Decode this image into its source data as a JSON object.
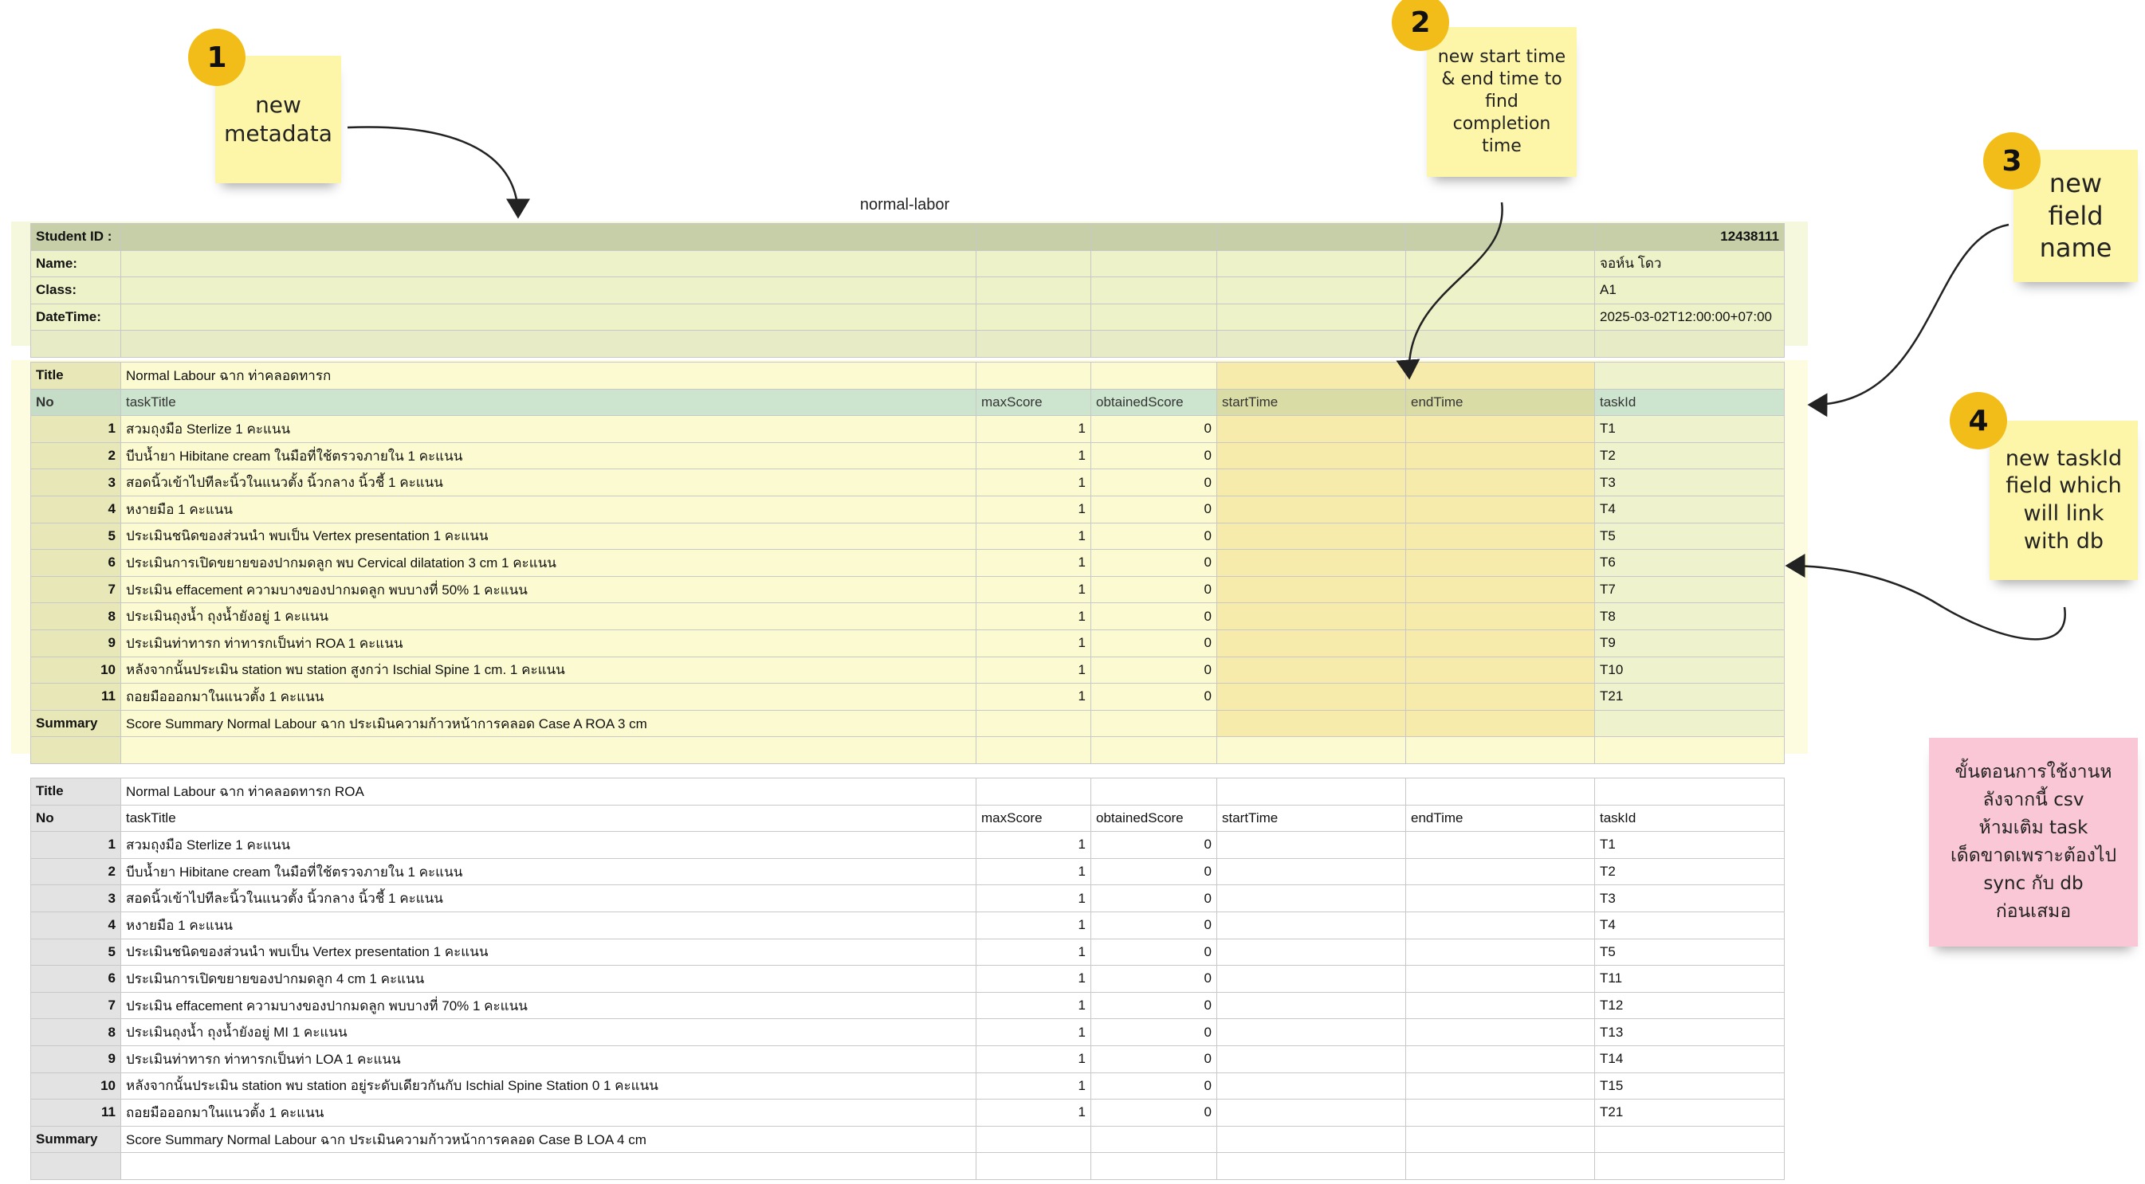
{
  "sheet_title": "normal-labor",
  "meta": {
    "rows": [
      {
        "label": "Student ID :",
        "value": "12438111"
      },
      {
        "label": "Name:",
        "value": "จอห์น โดว"
      },
      {
        "label": "Class:",
        "value": "A1"
      },
      {
        "label": "DateTime:",
        "value": "2025-03-02T12:00:00+07:00"
      }
    ]
  },
  "columns": [
    "No",
    "taskTitle",
    "maxScore",
    "obtainedScore",
    "startTime",
    "endTime",
    "taskId"
  ],
  "block1": {
    "title_label": "Title",
    "title": "Normal Labour ฉาก  ท่าคลอดทารก",
    "rows": [
      {
        "no": "1",
        "title": "สวมถุงมือ Sterlize 1 คะแนน",
        "max": "1",
        "obtained": "0",
        "taskId": "T1"
      },
      {
        "no": "2",
        "title": "บีบน้ำยา Hibitane cream ในมือที่ใช้ตรวจภายใน 1 คะแนน",
        "max": "1",
        "obtained": "0",
        "taskId": "T2"
      },
      {
        "no": "3",
        "title": "สอดนิ้วเข้าไปทีละนิ้วในแนวตั้ง นิ้วกลาง นิ้วชี้ 1 คะแนน",
        "max": "1",
        "obtained": "0",
        "taskId": "T3"
      },
      {
        "no": "4",
        "title": "หงายมือ 1 คะแนน",
        "max": "1",
        "obtained": "0",
        "taskId": "T4"
      },
      {
        "no": "5",
        "title": "ประเมินชนิดของส่วนนำ พบเป็น Vertex presentation 1 คะแนน",
        "max": "1",
        "obtained": "0",
        "taskId": "T5"
      },
      {
        "no": "6",
        "title": "ประเมินการเปิดขยายของปากมดลูก พบ Cervical dilatation 3 cm 1 คะแนน",
        "max": "1",
        "obtained": "0",
        "taskId": "T6"
      },
      {
        "no": "7",
        "title": "ประเมิน effacement ความบางของปากมดลูก พบบางที่ 50% 1 คะแนน",
        "max": "1",
        "obtained": "0",
        "taskId": "T7"
      },
      {
        "no": "8",
        "title": "ประเมินถุงน้ำ ถุงน้ำยังอยู่ 1 คะแนน",
        "max": "1",
        "obtained": "0",
        "taskId": "T8"
      },
      {
        "no": "9",
        "title": "ประเมินท่าทารก ท่าทารกเป็นท่า ROA 1 คะแนน",
        "max": "1",
        "obtained": "0",
        "taskId": "T9"
      },
      {
        "no": "10",
        "title": "หลังจากนั้นประเมิน station พบ station สูงกว่า Ischial Spine 1 cm. 1 คะแนน",
        "max": "1",
        "obtained": "0",
        "taskId": "T10"
      },
      {
        "no": "11",
        "title": "ถอยมือออกมาในแนวตั้ง 1 คะแนน",
        "max": "1",
        "obtained": "0",
        "taskId": "T21"
      }
    ],
    "summary_label": "Summary",
    "summary": "Score Summary Normal Labour ฉาก  ประเมินความก้าวหน้าการคลอด Case A ROA 3 cm"
  },
  "block2": {
    "title_label": "Title",
    "title": "Normal Labour ฉาก  ท่าคลอดทารก ROA",
    "rows": [
      {
        "no": "1",
        "title": "สวมถุงมือ Sterlize 1 คะแนน",
        "max": "1",
        "obtained": "0",
        "taskId": "T1"
      },
      {
        "no": "2",
        "title": "บีบน้ำยา Hibitane cream ในมือที่ใช้ตรวจภายใน 1 คะแนน",
        "max": "1",
        "obtained": "0",
        "taskId": "T2"
      },
      {
        "no": "3",
        "title": "สอดนิ้วเข้าไปทีละนิ้วในแนวตั้ง นิ้วกลาง นิ้วชี้ 1 คะแนน",
        "max": "1",
        "obtained": "0",
        "taskId": "T3"
      },
      {
        "no": "4",
        "title": "หงายมือ 1 คะแนน",
        "max": "1",
        "obtained": "0",
        "taskId": "T4"
      },
      {
        "no": "5",
        "title": "ประเมินชนิดของส่วนนำ พบเป็น Vertex presentation 1 คะแนน",
        "max": "1",
        "obtained": "0",
        "taskId": "T5"
      },
      {
        "no": "6",
        "title": "ประเมินการเปิดขยายของปากมดลูก 4 cm 1 คะแนน",
        "max": "1",
        "obtained": "0",
        "taskId": "T11"
      },
      {
        "no": "7",
        "title": "ประเมิน effacement ความบางของปากมดลูก พบบางที่ 70% 1 คะแนน",
        "max": "1",
        "obtained": "0",
        "taskId": "T12"
      },
      {
        "no": "8",
        "title": "ประเมินถุงน้ำ ถุงน้ำยังอยู่ MI 1 คะแนน",
        "max": "1",
        "obtained": "0",
        "taskId": "T13"
      },
      {
        "no": "9",
        "title": "ประเมินท่าทารก ท่าทารกเป็นท่า LOA 1 คะแนน",
        "max": "1",
        "obtained": "0",
        "taskId": "T14"
      },
      {
        "no": "10",
        "title": "หลังจากนั้นประเมิน station พบ station อยู่ระดับเดียวกันกับ Ischial Spine Station 0 1 คะแนน",
        "max": "1",
        "obtained": "0",
        "taskId": "T15"
      },
      {
        "no": "11",
        "title": "ถอยมือออกมาในแนวตั้ง 1 คะแนน",
        "max": "1",
        "obtained": "0",
        "taskId": "T21"
      }
    ],
    "summary_label": "Summary",
    "summary": "Score Summary Normal Labour ฉาก  ประเมินความก้าวหน้าการคลอด Case B LOA 4 cm"
  },
  "annotations": [
    {
      "number": "1",
      "lines": [
        "new",
        "metadata"
      ]
    },
    {
      "number": "2",
      "lines": [
        "new start time",
        "& end time to",
        "find",
        "completion",
        "time"
      ]
    },
    {
      "number": "3",
      "lines": [
        "new",
        "field",
        "name"
      ]
    },
    {
      "number": "4",
      "lines": [
        "new taskId",
        "field which",
        "will link",
        "with db"
      ]
    }
  ],
  "warning_note": {
    "lines": [
      "ขั้นตอนการใช้งานห",
      "ลังจากนี้ csv",
      "ห้ามเติม task",
      "เด็ดขาดเพราะต้องไป",
      "sync กับ db",
      "ก่อนเสมอ"
    ],
    "color": "#f9c7d6"
  },
  "colors": {
    "badge": "#f2bd19",
    "sticky": "#fdf6a9",
    "header_row": "#cde5cf",
    "time_columns": "#f7ebab",
    "taskid_column": "#eef3cd"
  }
}
